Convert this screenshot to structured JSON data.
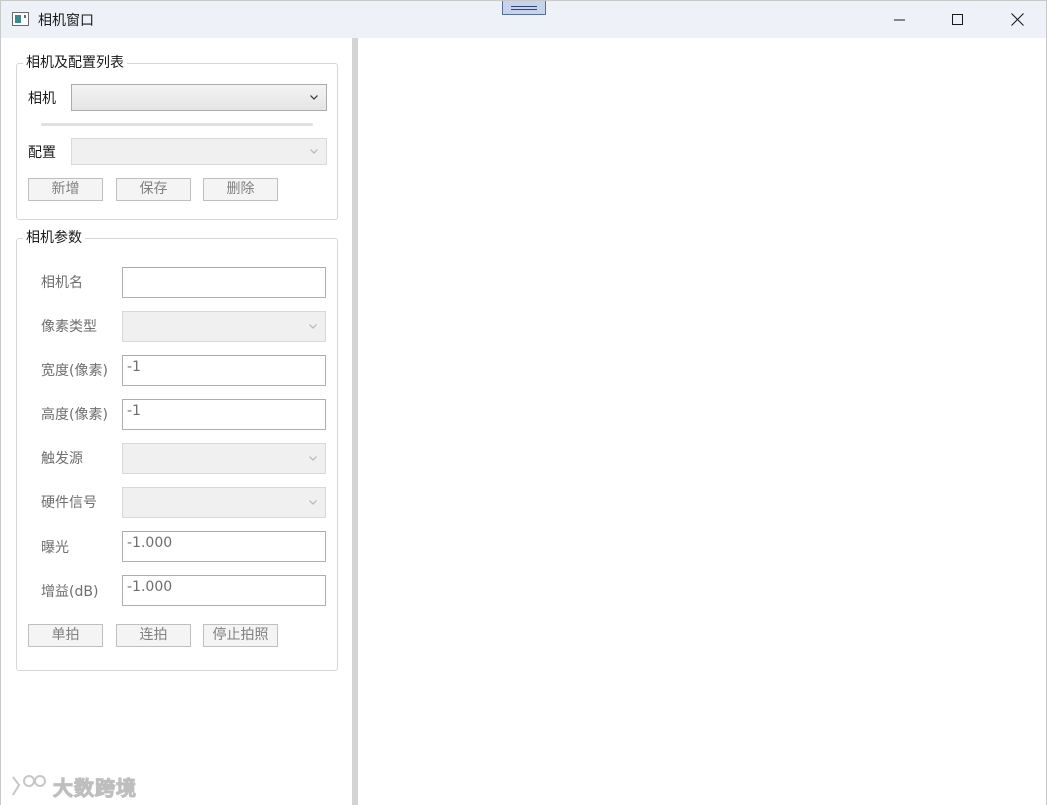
{
  "window": {
    "title": "相机窗口",
    "icon": "app-window-icon",
    "controls": [
      "minimize-icon",
      "maximize-icon",
      "close-icon"
    ]
  },
  "camera_config_group": {
    "title": "相机及配置列表",
    "camera_label": "相机",
    "camera_value": "",
    "config_label": "配置",
    "config_value": "",
    "buttons": {
      "add": "新增",
      "save": "保存",
      "delete": "删除"
    }
  },
  "camera_params_group": {
    "title": "相机参数",
    "fields": {
      "name_label": "相机名",
      "name_value": "",
      "pixel_type_label": "像素类型",
      "width_label": "宽度(像素)",
      "width_value": "-1",
      "height_label": "高度(像素)",
      "height_value": "-1",
      "trigger_source_label": "触发源",
      "hardware_signal_label": "硬件信号",
      "exposure_label": "曝光",
      "exposure_value": "-1.000",
      "gain_label": "增益(dB)",
      "gain_value": "-1.000"
    },
    "buttons": {
      "single_shot": "单拍",
      "continuous_shot": "连拍",
      "stop_shooting": "停止拍照"
    }
  },
  "watermark": {
    "text": "大数跨境"
  },
  "colors": {
    "titlebar_bg": "#eef1f8",
    "disabled_text": "#808080",
    "splitter": "#d4d4d4"
  }
}
